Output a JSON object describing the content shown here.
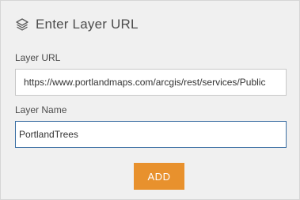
{
  "header": {
    "icon": "layers-icon",
    "title": "Enter Layer URL"
  },
  "form": {
    "url_label": "Layer URL",
    "url_value": "https://www.portlandmaps.com/arcgis/rest/services/Public",
    "name_label": "Layer Name",
    "name_value": "PortlandTrees"
  },
  "actions": {
    "add_label": "ADD"
  },
  "colors": {
    "panel_background": "#f0f0f0",
    "accent_button": "#e8912d",
    "focus_border": "#3b6fa3"
  }
}
